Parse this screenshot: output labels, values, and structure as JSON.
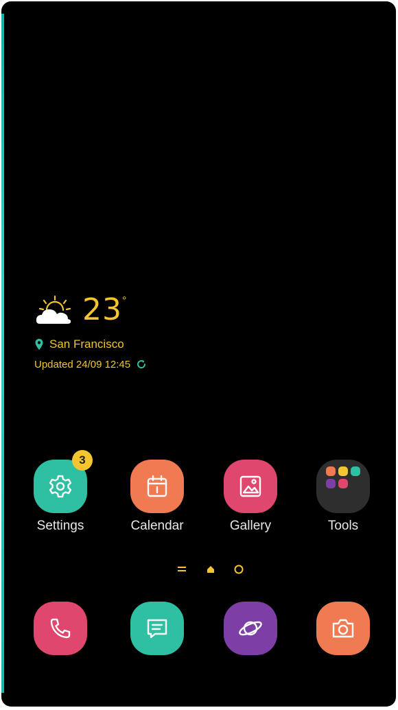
{
  "weather": {
    "icon": "partly-sunny-icon",
    "temperature": "23",
    "unit": "°",
    "location": "San Francisco",
    "updated": "Updated 24/09 12:45"
  },
  "apps": [
    {
      "label": "Settings",
      "icon": "gear-icon",
      "color": "#2fbfa3",
      "badge": "3"
    },
    {
      "label": "Calendar",
      "icon": "calendar-icon",
      "color": "#f07b52"
    },
    {
      "label": "Gallery",
      "icon": "picture-icon",
      "color": "#e0476f"
    },
    {
      "label": "Tools",
      "icon": "folder-icon",
      "color": "#2e2e2e"
    }
  ],
  "dock": [
    {
      "icon": "phone-icon",
      "color": "#e0476f"
    },
    {
      "icon": "message-icon",
      "color": "#2fbfa3"
    },
    {
      "icon": "internet-planet-icon",
      "color": "#7d3fa6"
    },
    {
      "icon": "camera-icon",
      "color": "#f07b52"
    }
  ],
  "page_indicators": [
    "menu-lines-icon",
    "home-dot-icon",
    "page-circle-icon"
  ],
  "colors": {
    "accent": "#f2c531",
    "edge": "#17b8a8",
    "background": "#000000"
  }
}
